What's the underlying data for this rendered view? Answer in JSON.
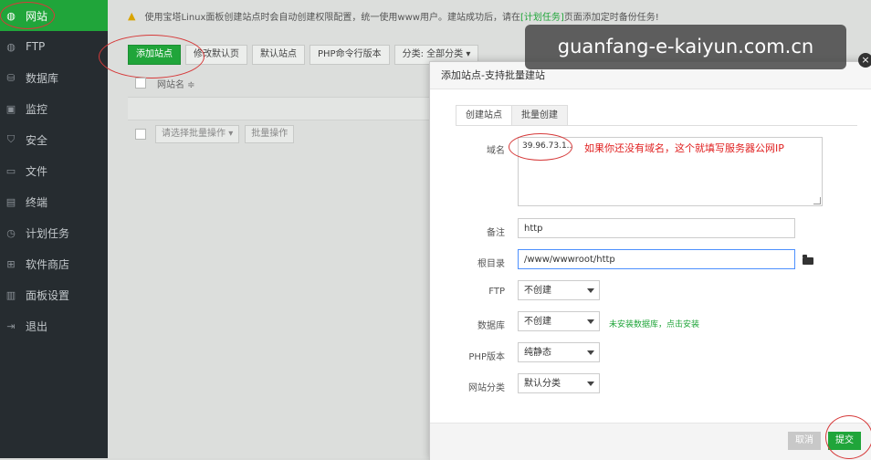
{
  "sidebar": {
    "items": [
      {
        "label": "网站",
        "icon": "globe-icon",
        "active": true
      },
      {
        "label": "FTP",
        "icon": "globe-icon"
      },
      {
        "label": "数据库",
        "icon": "database-icon"
      },
      {
        "label": "监控",
        "icon": "monitor-icon"
      },
      {
        "label": "安全",
        "icon": "shield-icon"
      },
      {
        "label": "文件",
        "icon": "folder-icon"
      },
      {
        "label": "终端",
        "icon": "terminal-icon"
      },
      {
        "label": "计划任务",
        "icon": "clock-icon"
      },
      {
        "label": "软件商店",
        "icon": "store-icon"
      },
      {
        "label": "面板设置",
        "icon": "settings-icon"
      },
      {
        "label": "退出",
        "icon": "logout-icon"
      }
    ]
  },
  "notice": {
    "text_before": "使用宝塔Linux面板创建站点时会自动创建权限配置，统一使用www用户。建站成功后，请在",
    "link": "[计划任务]",
    "text_after": "页面添加定时备份任务!"
  },
  "toolbar": {
    "add_site": "添加站点",
    "edit_default": "修改默认页",
    "default_site": "默认站点",
    "php_cli": "PHP命令行版本",
    "category": "分类: 全部分类"
  },
  "table": {
    "col_site_name": "网站名 ≑",
    "batch_select_placeholder": "请选择批量操作",
    "batch_action": "批量操作"
  },
  "modal": {
    "title": "添加站点-支持批量建站",
    "close": "×",
    "tabs": [
      "创建站点",
      "批量创建"
    ],
    "labels": {
      "domain": "域名",
      "remark": "备注",
      "root": "根目录",
      "ftp": "FTP",
      "database": "数据库",
      "php": "PHP版本",
      "category": "网站分类"
    },
    "domain_value": "39.96.73.1..",
    "annotation": "如果你还没有域名，这个就填写服务器公网IP",
    "remark_value": "http",
    "root_value": "/www/wwwroot/http",
    "ftp_value": "不创建",
    "db_value": "不创建",
    "db_hint": "未安装数据库，点击安装",
    "php_value": "纯静态",
    "category_value": "默认分类",
    "cancel": "取消",
    "submit": "提交"
  },
  "watermark": "guanfang-e-kaiyun.com.cn",
  "colors": {
    "accent": "#20a53a",
    "sidebar_bg": "#262c30",
    "annotation_red": "#e02020"
  }
}
